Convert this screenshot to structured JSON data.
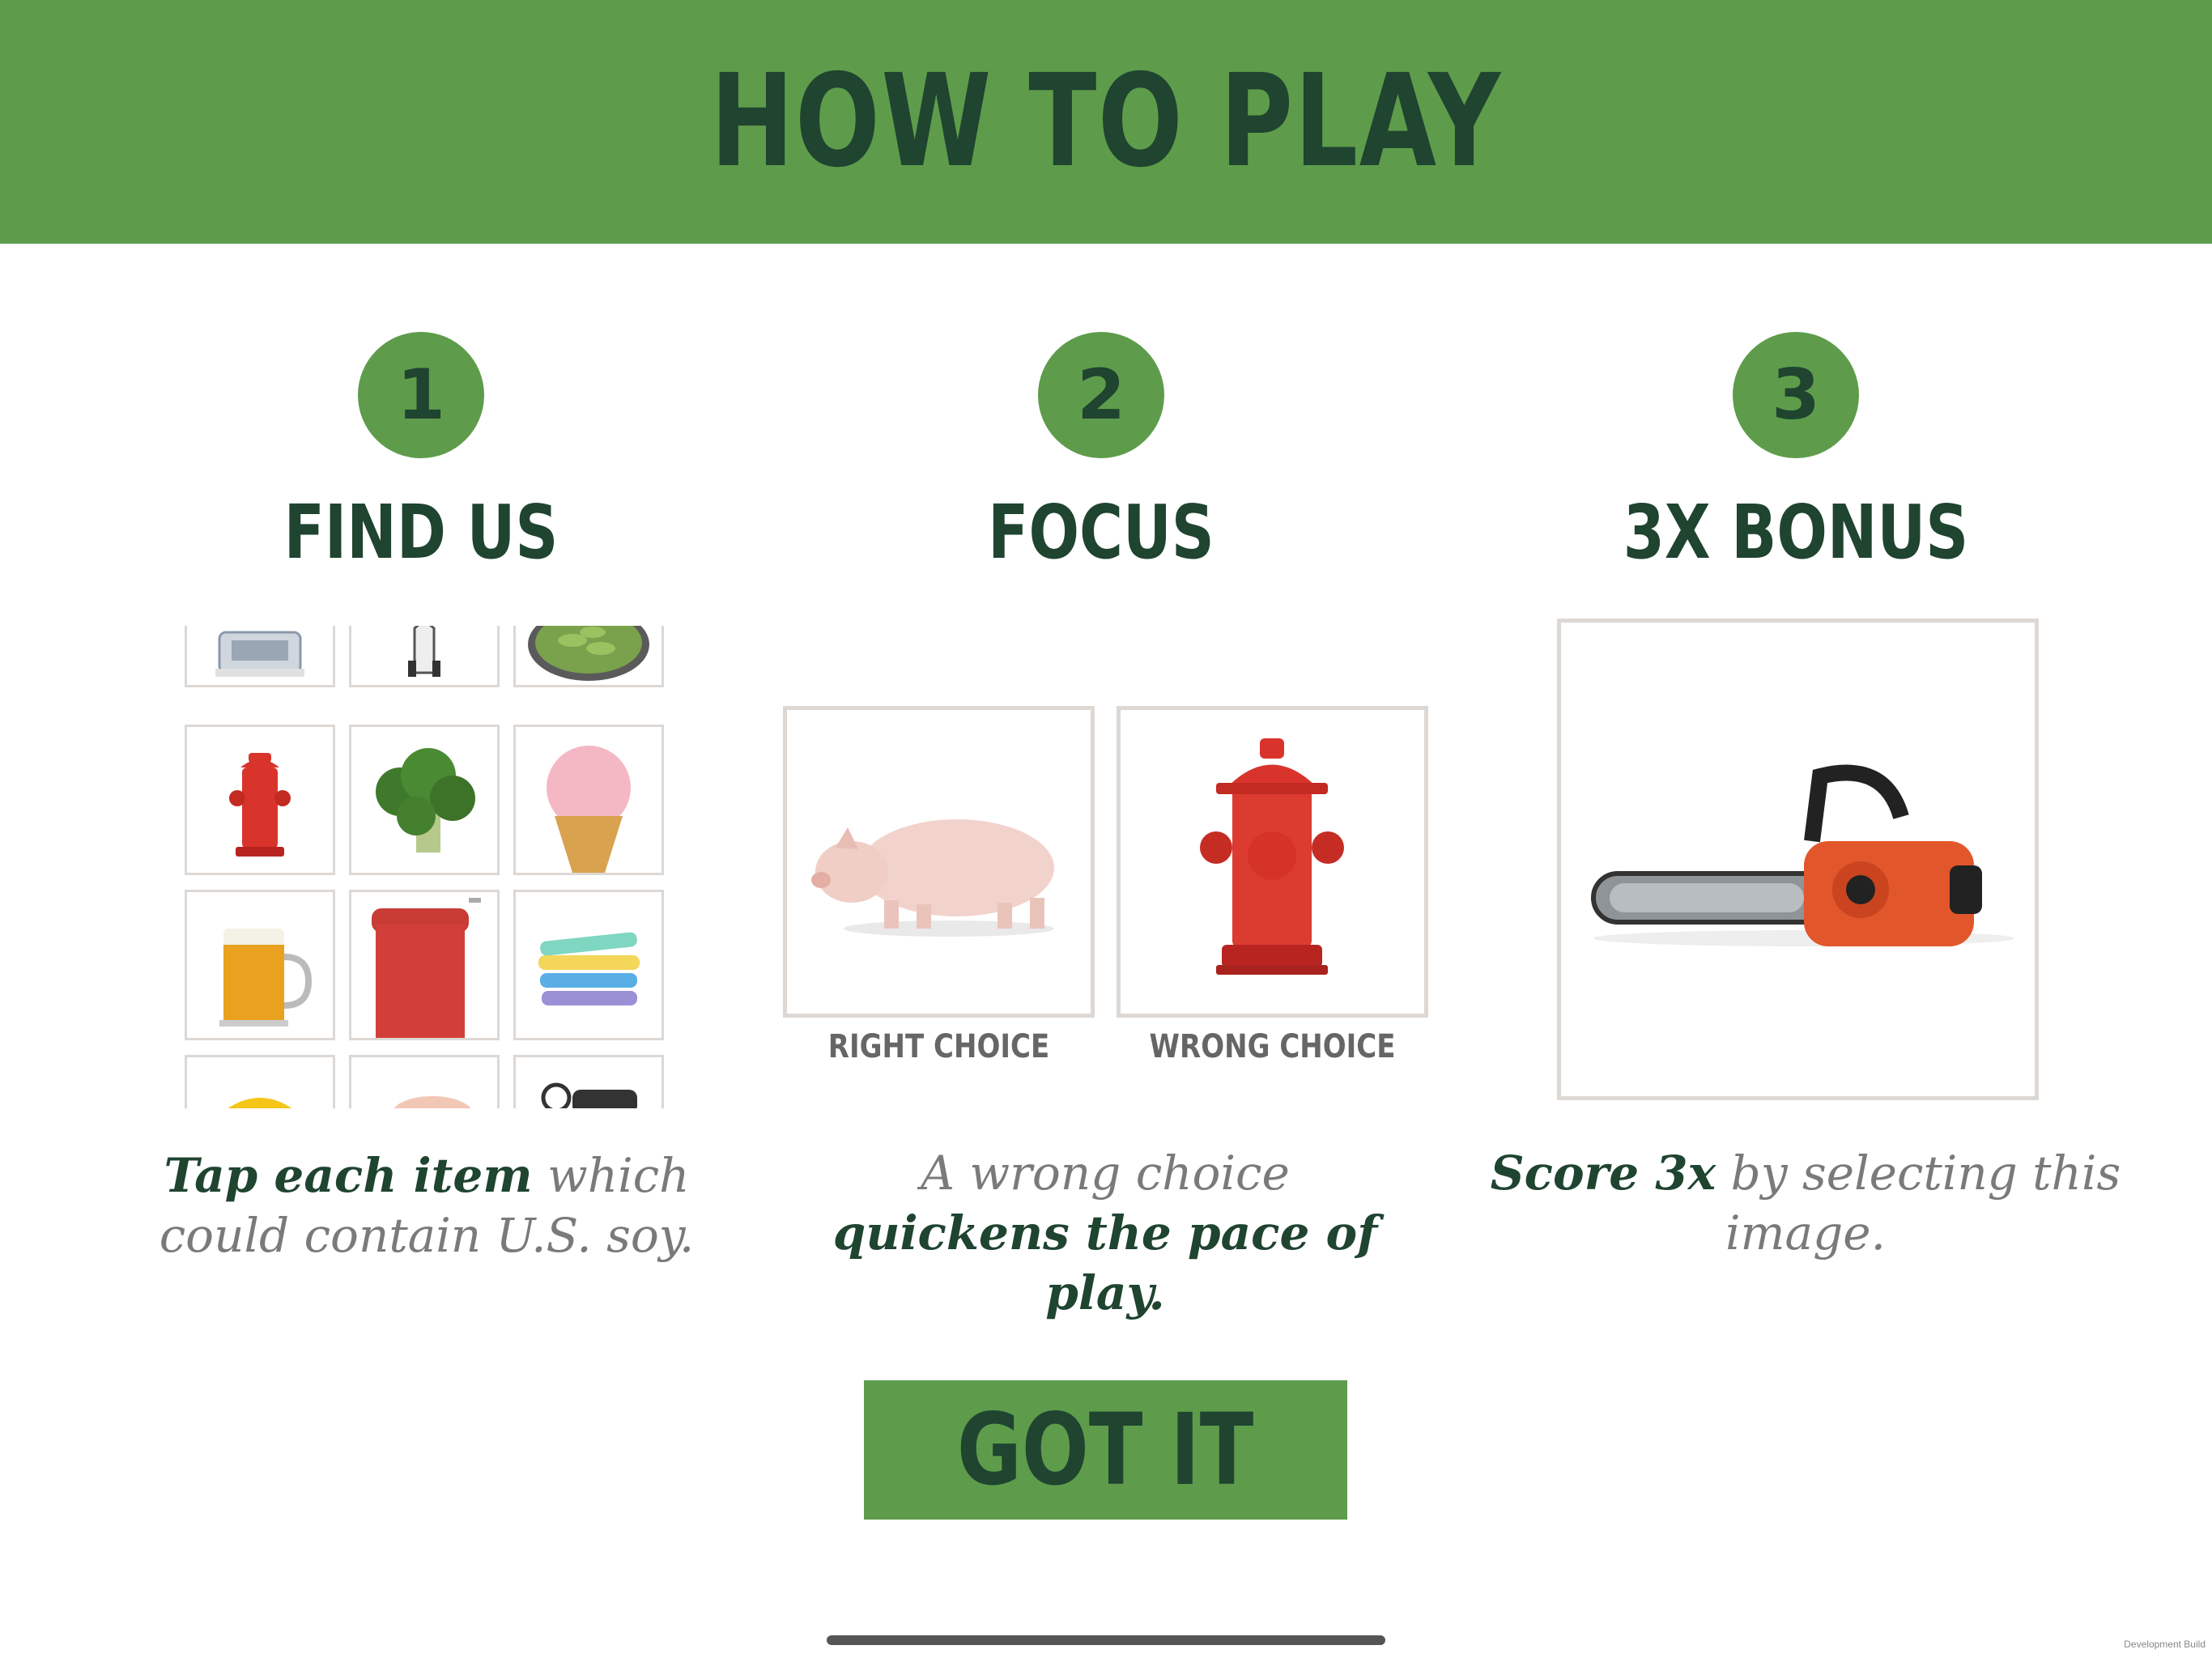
{
  "header": {
    "title": "HOW TO PLAY"
  },
  "steps": [
    {
      "number": "1",
      "title": "FIND  US",
      "desc_bold": "Tap each item",
      "desc_rest": " which could contain U.S. soy."
    },
    {
      "number": "2",
      "title": "FOCUS",
      "desc_line1": "A wrong choice",
      "desc_bold": "quickens the pace of play.",
      "right_label": "RIGHT CHOICE",
      "wrong_label": "WRONG CHOICE"
    },
    {
      "number": "3",
      "title": "3X BONUS",
      "desc_bold": "Score 3x",
      "desc_rest": " by selecting this image."
    }
  ],
  "button": {
    "label": "GOT IT"
  },
  "watermark": "Development Build",
  "colors": {
    "green": "#5e9c4b",
    "dark_green": "#1f4430",
    "gray_text": "#7a7a7a",
    "frame": "#ddd8d4"
  },
  "grid_items": [
    "truck",
    "space-shuttle",
    "edamame",
    "fire-hydrant",
    "broccoli",
    "ice-cream",
    "beer",
    "paint-roller",
    "chalk",
    "hard-hat",
    "soap",
    "car-keys"
  ]
}
